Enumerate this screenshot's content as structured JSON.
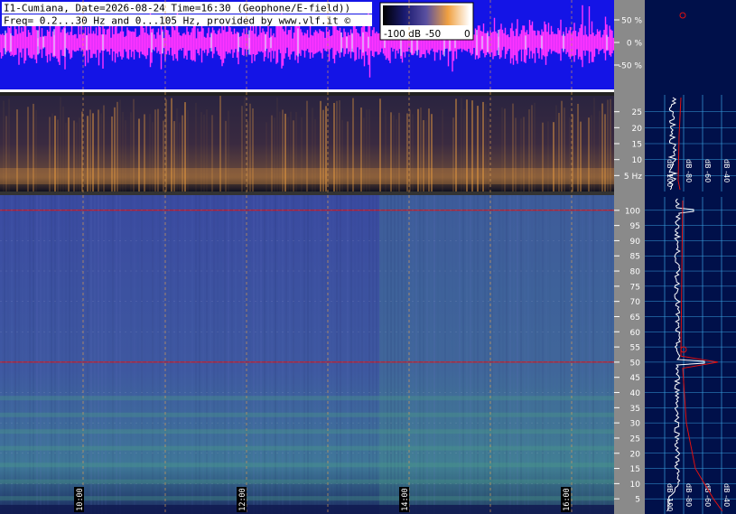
{
  "header": {
    "line1": "I1-Cumiana, Date=2026-08-24 Time=16:30 (Geophone/E-field))",
    "line2": "Freq= 0.2...30 Hz and 0...105 Hz, provided by www.vlf.it ©"
  },
  "colorbar": {
    "labels": [
      "-100 dB",
      "-50",
      "0"
    ]
  },
  "colors": {
    "waveform_bg": "#1414e6",
    "waveform": "#ff33ff",
    "low_spec_bg": "#1a1c3c",
    "low_spec_hot": "#f0a040",
    "high_spec_bg": "#3a4a9a",
    "high_spec_green": "#4a9a86",
    "right_panel_bg": "#00104a",
    "axis_bg": "#8a8a8a",
    "marker_red": "#e01010",
    "grid_cyan": "#3aa0e0"
  },
  "chart_data": [
    {
      "type": "line",
      "name": "amplitude-waveform",
      "ylim": [
        -100,
        100
      ],
      "y_tick_labels": [
        "50 %",
        "0 %",
        "-50 %"
      ],
      "y_ticks": [
        50,
        0,
        -50
      ]
    },
    {
      "type": "heatmap",
      "name": "spectrogram-0.2-30Hz",
      "ylim": [
        0,
        30
      ],
      "y_ticks": [
        25,
        20,
        15,
        10,
        5
      ],
      "y_tick_labels": [
        "25",
        "20",
        "15",
        "10",
        "5 Hz"
      ]
    },
    {
      "type": "heatmap",
      "name": "spectrogram-0-105Hz",
      "ylim": [
        0,
        105
      ],
      "y_ticks": [
        100,
        95,
        90,
        85,
        80,
        75,
        70,
        65,
        60,
        55,
        50,
        45,
        40,
        35,
        30,
        25,
        20,
        15,
        10,
        5
      ],
      "time_labels": [
        "10:00",
        "12:00",
        "14:00",
        "16:00"
      ],
      "hlines": [
        50,
        100
      ]
    },
    {
      "type": "line",
      "name": "spectrum-profiles",
      "x_tick_labels_top": [
        "dB -100",
        "dB -80",
        "dB -60",
        "dB -40",
        "dB -20"
      ],
      "x_tick_labels_bottom": [
        "dB -100",
        "dB -80",
        "dB -60",
        "dB -40",
        "dB -20"
      ],
      "peaks_hz": [
        50,
        100
      ]
    }
  ]
}
